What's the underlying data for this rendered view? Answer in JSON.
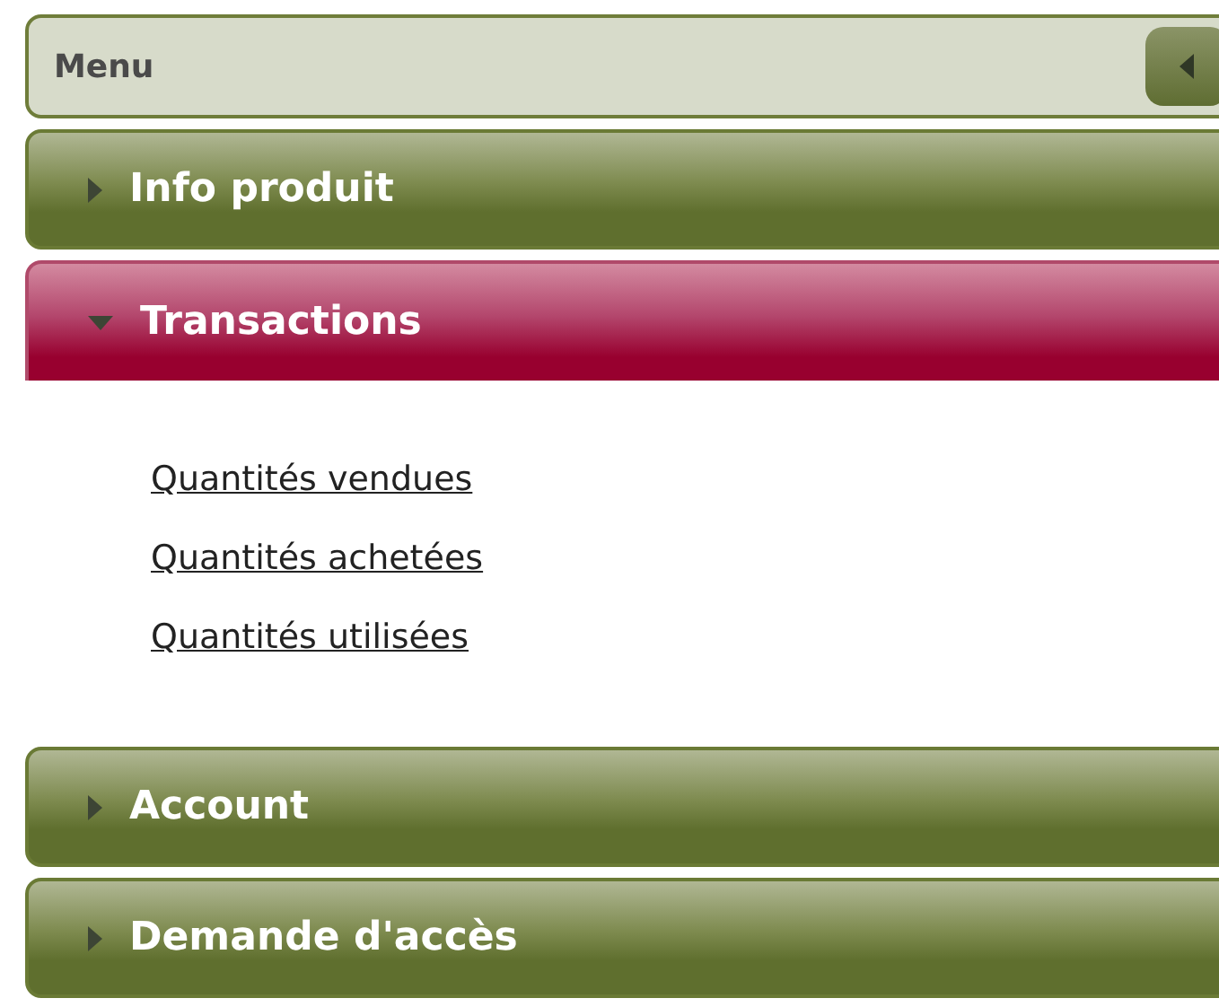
{
  "menu": {
    "title": "Menu"
  },
  "sections": [
    {
      "label": "Info produit",
      "expanded": false
    },
    {
      "label": "Transactions",
      "expanded": true,
      "links": [
        "Quantités vendues",
        "Quantités achetées",
        "Quantités utilisées"
      ]
    },
    {
      "label": "Account",
      "expanded": false
    },
    {
      "label": "Demande d'accès",
      "expanded": false
    }
  ]
}
